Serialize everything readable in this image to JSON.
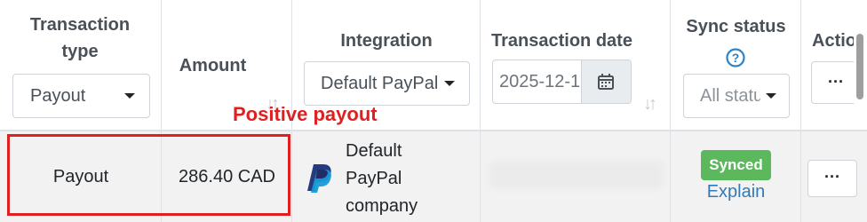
{
  "columns": {
    "transaction_type": {
      "label": "Transaction type",
      "filter_value": "Payout"
    },
    "amount": {
      "label": "Amount"
    },
    "integration": {
      "label": "Integration",
      "filter_value": "Default PayPal"
    },
    "transaction_date": {
      "label": "Transaction date",
      "filter_value": "2025-12-1"
    },
    "sync_status": {
      "label": "Sync status",
      "filter_placeholder": "All statuses"
    },
    "actions": {
      "label": "Actions"
    }
  },
  "annotation": {
    "text": "Positive payout",
    "color": "#e02020"
  },
  "row": {
    "transaction_type": "Payout",
    "amount": "286.40 CAD",
    "integration_name": "Default PayPal company",
    "sync_badge": "Synced",
    "explain_link": "Explain",
    "more_label": "···"
  },
  "colors": {
    "badge_green": "#5cb85c",
    "link_blue": "#337ab7",
    "row_bg": "#f2f2f2"
  },
  "icons": {
    "help": "question-circle-icon",
    "calendar": "calendar-icon",
    "sort": "sort-icon",
    "paypal": "paypal-logo"
  }
}
